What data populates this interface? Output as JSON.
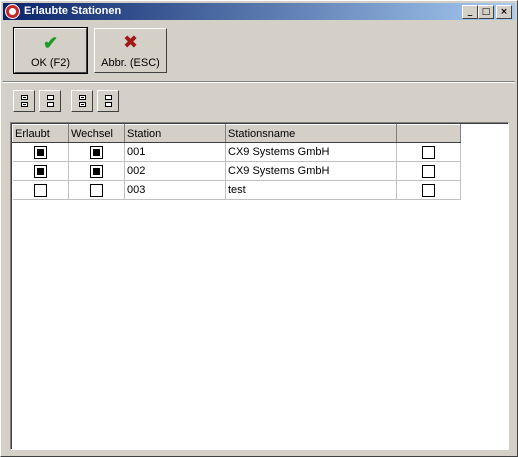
{
  "window": {
    "title": "Erlaubte Stationen",
    "controls": {
      "minimize": "_",
      "maximize": "□",
      "close": "×"
    }
  },
  "toolbar": {
    "ok": {
      "label": "OK (F2)",
      "icon": "check-icon",
      "glyph": "✔",
      "color": "#1e9a2a"
    },
    "cancel": {
      "label": "Abbr. (ESC)",
      "icon": "x-icon",
      "glyph": "✖",
      "color": "#a01818"
    }
  },
  "small_buttons": [
    {
      "icon": "select-all-icon"
    },
    {
      "icon": "deselect-all-icon"
    },
    {
      "icon": "select-all-icon"
    },
    {
      "icon": "deselect-all-icon"
    }
  ],
  "grid": {
    "columns": [
      "Erlaubt",
      "Wechsel",
      "Station",
      "Stationsname",
      ""
    ],
    "rows": [
      {
        "erlaubt": true,
        "wechsel": true,
        "station": "001",
        "name": "CX9 Systems GmbH",
        "extra": false
      },
      {
        "erlaubt": true,
        "wechsel": true,
        "station": "002",
        "name": "CX9 Systems GmbH",
        "extra": false
      },
      {
        "erlaubt": false,
        "wechsel": false,
        "station": "003",
        "name": "test",
        "extra": false
      }
    ]
  }
}
